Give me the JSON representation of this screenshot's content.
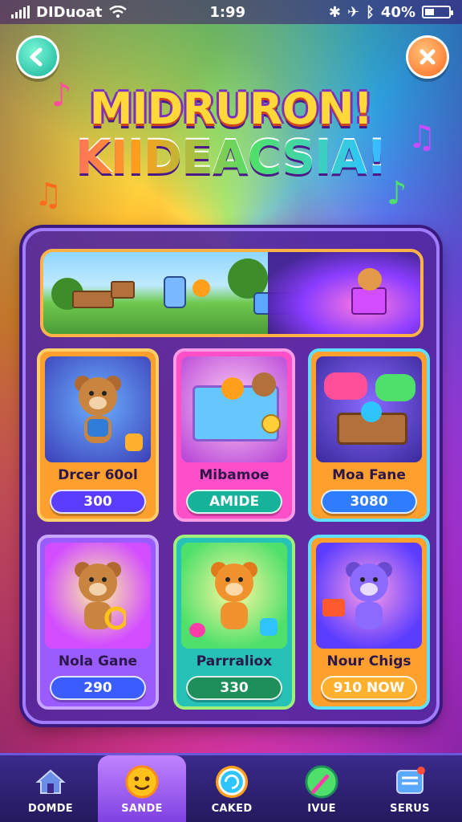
{
  "status_bar": {
    "carrier": "DIDuoat",
    "time": "1:99",
    "battery": "40%"
  },
  "header": {
    "title_line1": "MIDRURON!",
    "title_line2": "KIIDEACSIA!"
  },
  "games": [
    {
      "name": "Drcer 60ol",
      "button": "300",
      "theme": "orange"
    },
    {
      "name": "Mibamoe",
      "button": "AMIDE",
      "theme": "pink"
    },
    {
      "name": "Moa Fane",
      "button": "3080",
      "theme": "teal"
    },
    {
      "name": "Nola Gane",
      "button": "290",
      "theme": "purple"
    },
    {
      "name": "Parrraliox",
      "button": "330",
      "theme": "green"
    },
    {
      "name": "Nour Chigs",
      "button": "910 NOW",
      "theme": "orange"
    }
  ],
  "bottom_nav": [
    {
      "label": "DOMDE",
      "icon": "home-icon"
    },
    {
      "label": "SANDE",
      "icon": "smiley-icon",
      "active": true
    },
    {
      "label": "CAKED",
      "icon": "refresh-icon"
    },
    {
      "label": "IVUE",
      "icon": "gem-icon"
    },
    {
      "label": "SERUS",
      "icon": "settings-icon"
    }
  ],
  "colors": {
    "panel": "#5428a0",
    "accent_orange": "#ff9f1a",
    "accent_teal": "#16b39a",
    "accent_pink": "#ff3da8",
    "button_blue": "#3b5cff"
  }
}
